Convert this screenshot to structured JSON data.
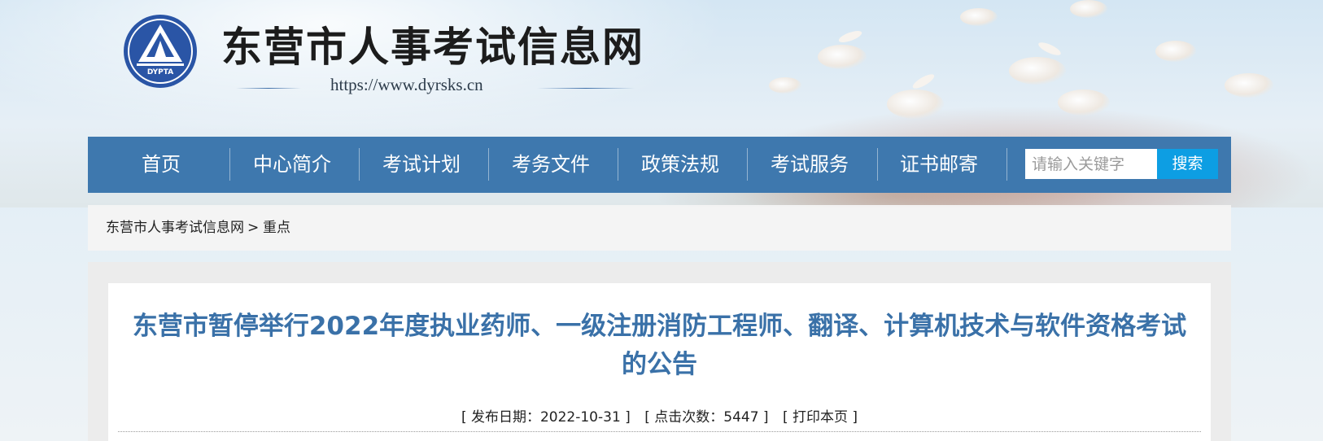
{
  "site": {
    "title": "东营市人事考试信息网",
    "url": "https://www.dyrsks.cn",
    "logo_text": "DYPTA"
  },
  "nav": {
    "items": [
      {
        "label": "首页"
      },
      {
        "label": "中心简介"
      },
      {
        "label": "考试计划"
      },
      {
        "label": "考务文件"
      },
      {
        "label": "政策法规"
      },
      {
        "label": "考试服务"
      },
      {
        "label": "证书邮寄"
      }
    ],
    "search_placeholder": "请输入关键字",
    "search_button": "搜索"
  },
  "breadcrumb": {
    "home": "东营市人事考试信息网",
    "separator": ">",
    "current": "重点"
  },
  "article": {
    "title": "东营市暂停举行2022年度执业药师、一级注册消防工程师、翻译、计算机技术与软件资格考试的公告",
    "publish_date": "[ 发布日期：2022-10-31 ]",
    "views": "[ 点击次数：5447 ]",
    "print": "[ 打印本页 ]"
  },
  "colors": {
    "nav_bg": "#3e78ae",
    "search_button_bg": "#0d9ee3",
    "title_color": "#3a71a8"
  }
}
